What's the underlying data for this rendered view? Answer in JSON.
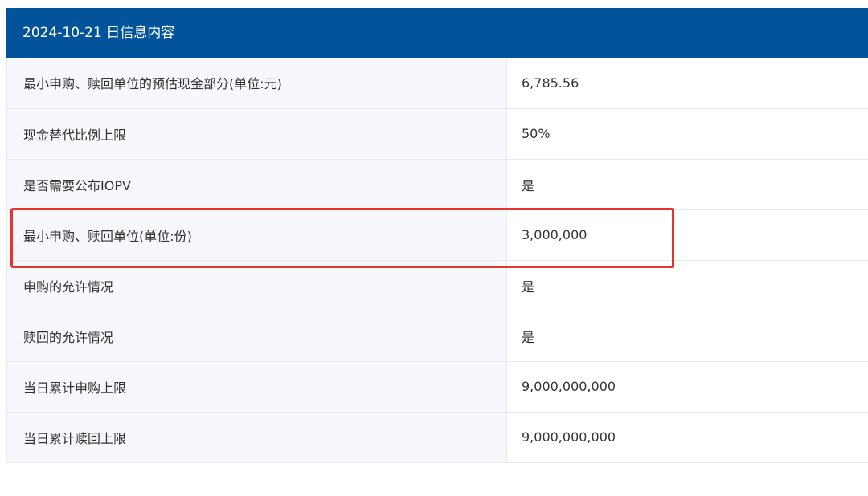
{
  "header": {
    "title": "2024-10-21 日信息内容"
  },
  "rows": [
    {
      "label": "最小申购、赎回单位的预估现金部分(单位:元)",
      "value": "6,785.56"
    },
    {
      "label": "现金替代比例上限",
      "value": "50%"
    },
    {
      "label": "是否需要公布IOPV",
      "value": "是"
    },
    {
      "label": "最小申购、赎回单位(单位:份)",
      "value": "3,000,000"
    },
    {
      "label": "申购的允许情况",
      "value": "是"
    },
    {
      "label": "赎回的允许情况",
      "value": "是"
    },
    {
      "label": "当日累计申购上限",
      "value": "9,000,000,000"
    },
    {
      "label": "当日累计赎回上限",
      "value": "9,000,000,000"
    }
  ],
  "highlight": {
    "row": 4,
    "color": "#e8332f"
  },
  "colors": {
    "header_bg": "#02549a",
    "label_bg": "#f7f8fc",
    "border": "#e7e9ee",
    "text": "#333333"
  }
}
